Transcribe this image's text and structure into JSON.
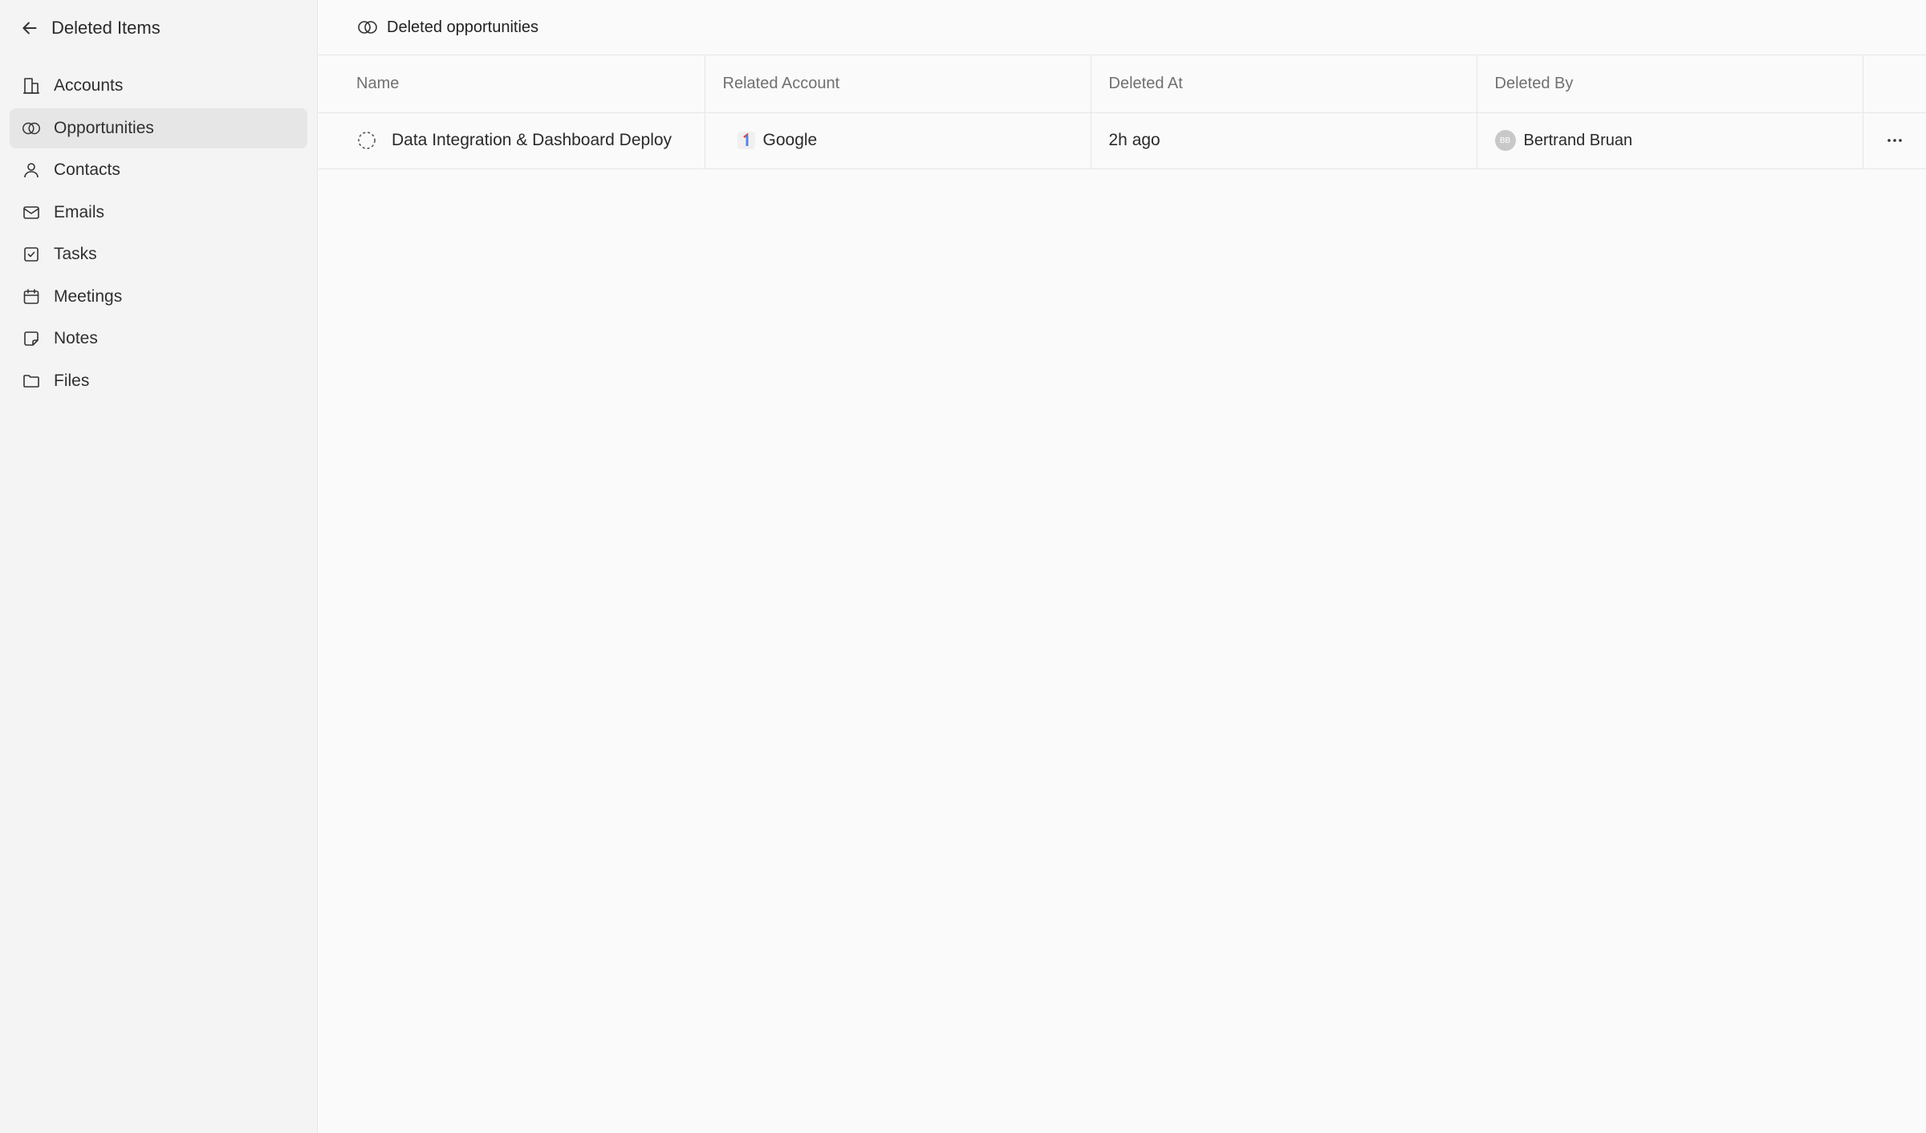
{
  "sidebar": {
    "title": "Deleted Items",
    "items": [
      {
        "label": "Accounts",
        "icon": "building-icon"
      },
      {
        "label": "Opportunities",
        "icon": "opportunity-icon",
        "active": true
      },
      {
        "label": "Contacts",
        "icon": "person-icon"
      },
      {
        "label": "Emails",
        "icon": "mail-icon"
      },
      {
        "label": "Tasks",
        "icon": "checkbox-icon"
      },
      {
        "label": "Meetings",
        "icon": "calendar-icon"
      },
      {
        "label": "Notes",
        "icon": "note-icon"
      },
      {
        "label": "Files",
        "icon": "folder-icon"
      }
    ]
  },
  "main": {
    "title": "Deleted opportunities",
    "columns": [
      "Name",
      "Related Account",
      "Deleted At",
      "Deleted By"
    ],
    "rows": [
      {
        "name": "Data Integration & Dashboard Deploy",
        "account": "Google",
        "deleted_at": "2h ago",
        "deleted_by": "Bertrand Bruan",
        "deleted_by_initials": "BB"
      }
    ]
  },
  "colors": {
    "sidebar_bg": "#f4f4f4",
    "active_item_bg": "#e6e6e6",
    "main_bg": "#fafafa",
    "border": "#e6e6e6"
  }
}
